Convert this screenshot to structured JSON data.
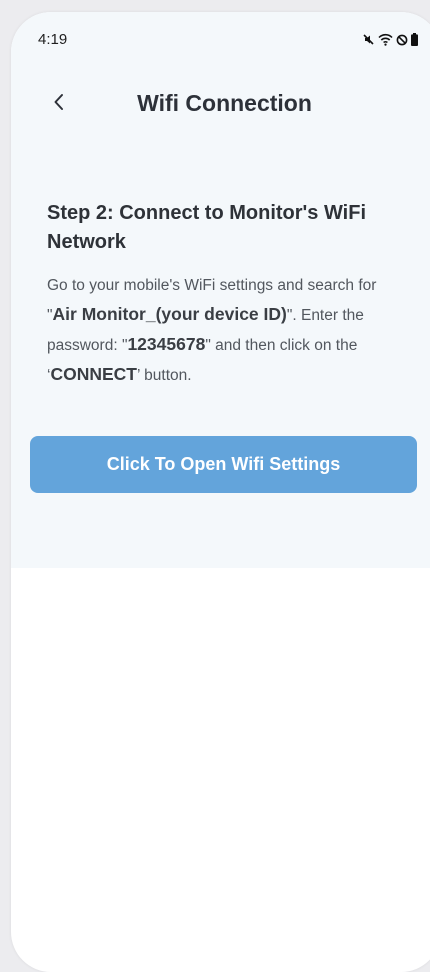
{
  "status_bar": {
    "time": "4:19",
    "icons": [
      "mute-icon",
      "wifi-icon",
      "do-not-disturb-icon",
      "battery-icon"
    ]
  },
  "header": {
    "title": "Wifi Connection",
    "back_icon": "chevron-left-icon"
  },
  "step": {
    "title": "Step 2: Connect to Monitor's WiFi Network",
    "instructions": {
      "part1": "Go to your mobile's WiFi settings and search for \"",
      "network_name": "Air Monitor_(your device ID)",
      "part2": "\". Enter the password: \"",
      "password": "12345678",
      "part3": "\" and then click on the ‘",
      "connect_label": "CONNECT",
      "part4": "’ button."
    }
  },
  "button": {
    "label": "Click To Open Wifi Settings"
  },
  "colors": {
    "panel_bg": "#f4f8fb",
    "accent": "#63a4db",
    "title_text": "#2d3139"
  }
}
